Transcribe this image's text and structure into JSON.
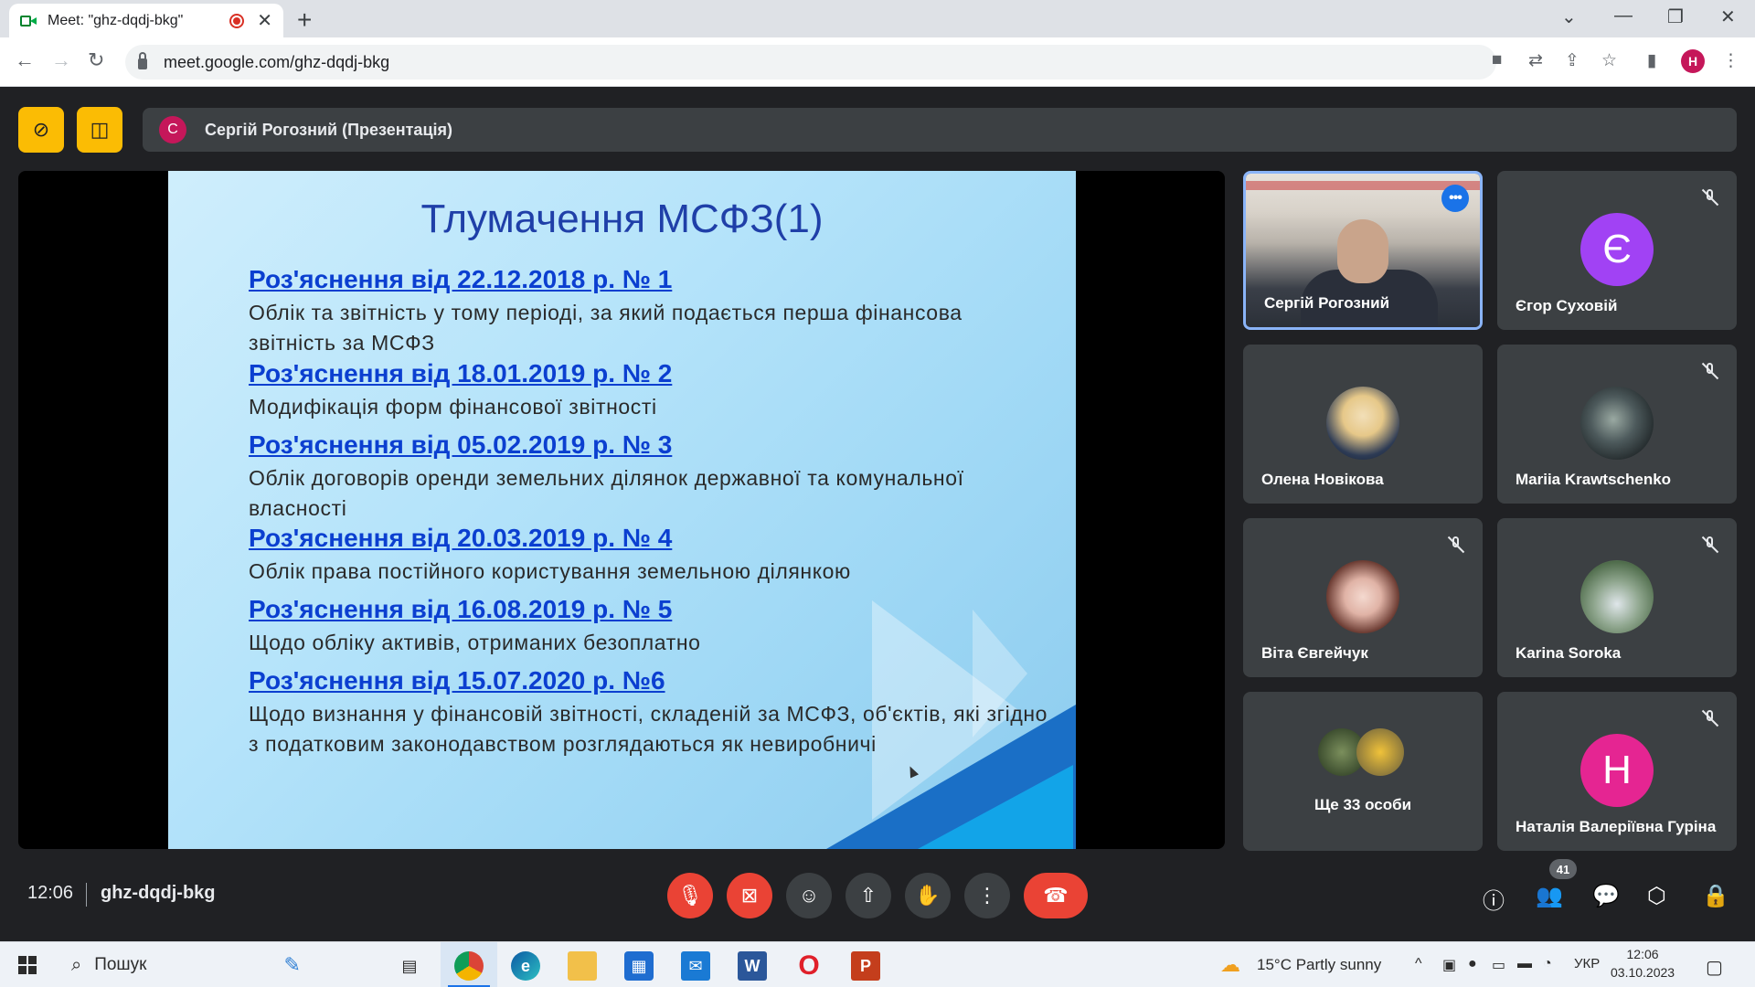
{
  "browser": {
    "tab_title": "Meet: \"ghz-dqdj-bkg\"",
    "url": "meet.google.com/ghz-dqdj-bkg",
    "profile_initial": "H"
  },
  "presenter_bar": {
    "avatar_initial": "С",
    "label": "Сергій Рогозний (Презентація)"
  },
  "slide": {
    "title": "Тлумачення МСФЗ(1)",
    "items": [
      {
        "link": "Роз'яснення від 22.12.2018 р. № 1",
        "desc": "Облік та звітність у тому періоді, за який подається перша фінансова звітність за МСФЗ"
      },
      {
        "link": "Роз'яснення від 18.01.2019 р. № 2",
        "desc": "Модифікація форм фінансової звітності"
      },
      {
        "link": "Роз'яснення від 05.02.2019 р. № 3",
        "desc": "Облік договорів оренди земельних ділянок державної та комунальної власності"
      },
      {
        "link": "Роз'яснення від 20.03.2019 р. № 4",
        "desc": "Облік права постійного користування земельною ділянкою"
      },
      {
        "link": "Роз'яснення від 16.08.2019 р. № 5",
        "desc": "Щодо обліку активів, отриманих безоплатно"
      },
      {
        "link": "Роз'яснення від 15.07.2020 р. №6",
        "desc": "Щодо визнання у фінансовій звітності, складеній за МСФЗ, об'єктів, які згідно з податковим законодавством розглядаються як невиробничі"
      }
    ]
  },
  "participants": [
    {
      "name": "Сергій Рогозний"
    },
    {
      "name": "Єгор Суховій",
      "initial": "Є",
      "color": "#a142f4"
    },
    {
      "name": "Олена Новікова"
    },
    {
      "name": "Mariia Krawtschenko"
    },
    {
      "name": "Віта Євгейчук"
    },
    {
      "name": "Karina Soroka"
    },
    {
      "name": "Ще 33 особи"
    },
    {
      "name": "Наталія Валеріївна Гуріна",
      "initial": "Н",
      "color": "#e52592"
    }
  ],
  "bottom_bar": {
    "time": "12:06",
    "meeting_code": "ghz-dqdj-bkg",
    "participant_count": "41"
  },
  "taskbar": {
    "search_label": "Пошук",
    "weather": "15°C  Partly sunny",
    "language": "УКР",
    "time": "12:06",
    "date": "03.10.2023"
  }
}
